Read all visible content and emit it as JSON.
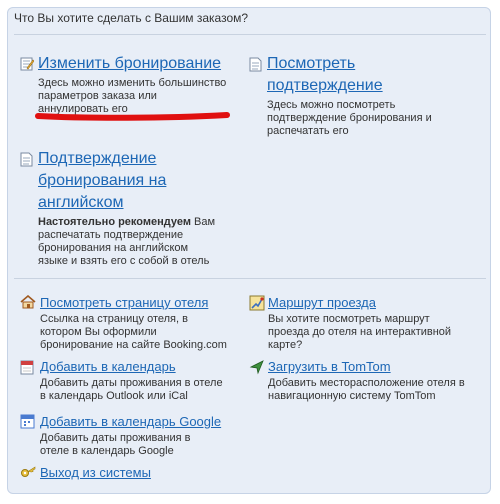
{
  "header": "Что Вы хотите сделать с Вашим заказом?",
  "items": {
    "change": {
      "title": "Изменить бронирование",
      "desc": "Здесь можно изменить большинство параметров заказа или аннулировать его"
    },
    "view_confirmation": {
      "title": "Посмотреть подтверждение",
      "desc": "Здесь можно посмотреть подтверждение бронирования и распечатать его"
    },
    "english_confirmation": {
      "title": "Подтверждение бронирования на английском",
      "desc_bold": "Настоятельно рекомендуем",
      "desc": " Вам распечатать подтверждение бронирования на английском языке и взять его с собой в отель"
    },
    "hotel_page": {
      "title": "Посмотреть страницу отеля",
      "desc": "Ссылка на страницу отеля, в котором Вы оформили бронирование на сайте Booking.com"
    },
    "route": {
      "title": "Маршрут проезда",
      "desc": "Вы хотите посмотреть маршрут проезда до отеля на интерактивной карте?"
    },
    "calendar": {
      "title": "Добавить в календарь",
      "desc": "Добавить даты проживания в отеле в календарь Outlook или iCal"
    },
    "tomtom": {
      "title": "Загрузить в TomTom",
      "desc": "Добавить месторасположение отеля в навигационную систему TomTom"
    },
    "google_calendar": {
      "title": "Добавить в календарь Google",
      "desc": "Добавить даты проживания в отеле в календарь Google"
    },
    "logout": {
      "title": "Выход из системы"
    }
  },
  "colors": {
    "link": "#1d67b5",
    "panel_bg": "#e8eef7",
    "annotation_red": "#e01010"
  }
}
